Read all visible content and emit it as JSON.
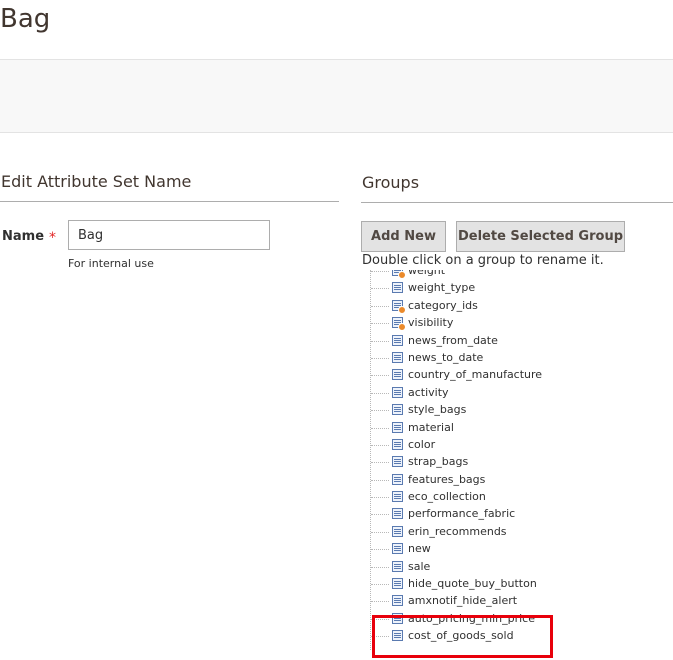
{
  "page": {
    "title": "Bag"
  },
  "edit_section": {
    "title": "Edit Attribute Set Name",
    "name_label": "Name",
    "required_mark": "*",
    "name_value": "Bag",
    "note": "For internal use"
  },
  "groups_section": {
    "title": "Groups",
    "add_new_label": "Add New",
    "delete_group_label": "Delete Selected Group",
    "hint": "Double click on a group to rename it."
  },
  "tree": {
    "items": [
      {
        "label": "weight",
        "system": true
      },
      {
        "label": "weight_type",
        "system": false
      },
      {
        "label": "category_ids",
        "system": true
      },
      {
        "label": "visibility",
        "system": true
      },
      {
        "label": "news_from_date",
        "system": false
      },
      {
        "label": "news_to_date",
        "system": false
      },
      {
        "label": "country_of_manufacture",
        "system": false
      },
      {
        "label": "activity",
        "system": false
      },
      {
        "label": "style_bags",
        "system": false
      },
      {
        "label": "material",
        "system": false
      },
      {
        "label": "color",
        "system": false
      },
      {
        "label": "strap_bags",
        "system": false
      },
      {
        "label": "features_bags",
        "system": false
      },
      {
        "label": "eco_collection",
        "system": false
      },
      {
        "label": "performance_fabric",
        "system": false
      },
      {
        "label": "erin_recommends",
        "system": false
      },
      {
        "label": "new",
        "system": false
      },
      {
        "label": "sale",
        "system": false
      },
      {
        "label": "hide_quote_buy_button",
        "system": false
      },
      {
        "label": "amxnotif_hide_alert",
        "system": false
      },
      {
        "label": "auto_pricing_min_price",
        "system": false
      },
      {
        "label": "cost_of_goods_sold",
        "system": false
      }
    ]
  },
  "colors": {
    "highlight": "#e8000b",
    "required": "#e22626"
  }
}
